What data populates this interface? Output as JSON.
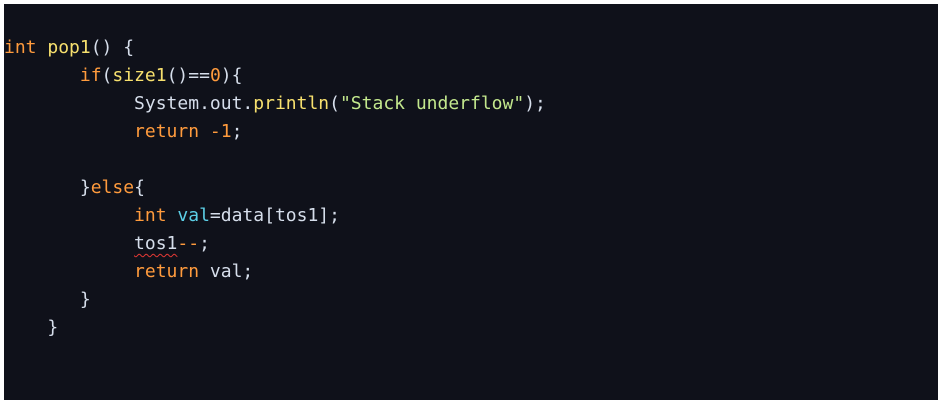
{
  "code": {
    "line1": {
      "kw": "int",
      "name": "pop1",
      "rest": "() {"
    },
    "line2": {
      "kw": "if",
      "open": "(",
      "call": "size1",
      "mid": "()==",
      "num": "0",
      "close": "){"
    },
    "line3": {
      "obj": "System.out.",
      "call": "println",
      "open": "(",
      "str": "\"Stack underflow\"",
      "close": ");"
    },
    "line4": {
      "kw": "return",
      "num": " -1",
      "rest": ";"
    },
    "line6": {
      "rest": "}",
      "kw": "else",
      "brace": "{"
    },
    "line7": {
      "kw": "int",
      "var": "val",
      "rest": "=data[tos1];"
    },
    "line8": {
      "ident": "tos1",
      "op": "--",
      "rest": ";"
    },
    "line9": {
      "kw": "return",
      "rest": " val;"
    },
    "line10": {
      "rest": "}"
    },
    "line11": {
      "rest": "}"
    }
  }
}
